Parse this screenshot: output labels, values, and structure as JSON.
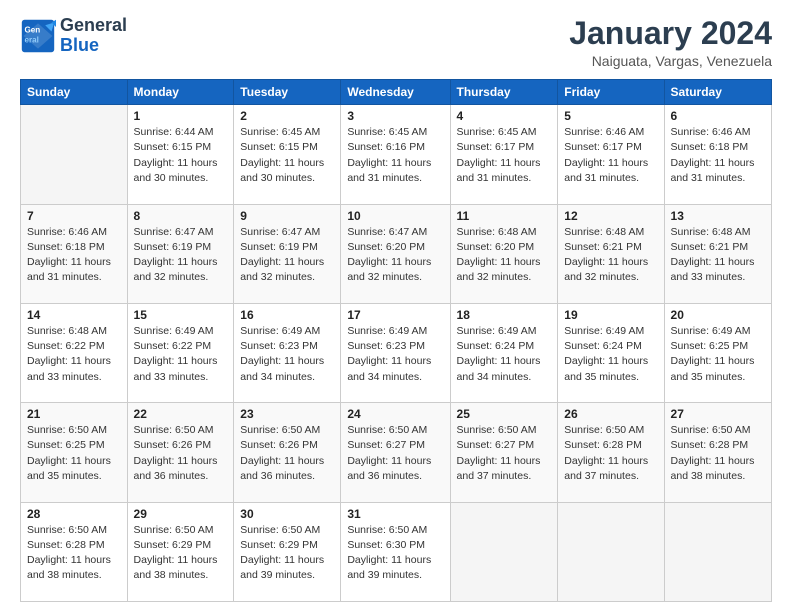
{
  "logo": {
    "line1": "General",
    "line2": "Blue"
  },
  "header": {
    "title": "January 2024",
    "location": "Naiguata, Vargas, Venezuela"
  },
  "weekdays": [
    "Sunday",
    "Monday",
    "Tuesday",
    "Wednesday",
    "Thursday",
    "Friday",
    "Saturday"
  ],
  "weeks": [
    [
      {
        "day": "",
        "empty": true
      },
      {
        "day": "1",
        "sunrise": "Sunrise: 6:44 AM",
        "sunset": "Sunset: 6:15 PM",
        "daylight": "Daylight: 11 hours and 30 minutes."
      },
      {
        "day": "2",
        "sunrise": "Sunrise: 6:45 AM",
        "sunset": "Sunset: 6:15 PM",
        "daylight": "Daylight: 11 hours and 30 minutes."
      },
      {
        "day": "3",
        "sunrise": "Sunrise: 6:45 AM",
        "sunset": "Sunset: 6:16 PM",
        "daylight": "Daylight: 11 hours and 31 minutes."
      },
      {
        "day": "4",
        "sunrise": "Sunrise: 6:45 AM",
        "sunset": "Sunset: 6:17 PM",
        "daylight": "Daylight: 11 hours and 31 minutes."
      },
      {
        "day": "5",
        "sunrise": "Sunrise: 6:46 AM",
        "sunset": "Sunset: 6:17 PM",
        "daylight": "Daylight: 11 hours and 31 minutes."
      },
      {
        "day": "6",
        "sunrise": "Sunrise: 6:46 AM",
        "sunset": "Sunset: 6:18 PM",
        "daylight": "Daylight: 11 hours and 31 minutes."
      }
    ],
    [
      {
        "day": "7",
        "sunrise": "Sunrise: 6:46 AM",
        "sunset": "Sunset: 6:18 PM",
        "daylight": "Daylight: 11 hours and 31 minutes."
      },
      {
        "day": "8",
        "sunrise": "Sunrise: 6:47 AM",
        "sunset": "Sunset: 6:19 PM",
        "daylight": "Daylight: 11 hours and 32 minutes."
      },
      {
        "day": "9",
        "sunrise": "Sunrise: 6:47 AM",
        "sunset": "Sunset: 6:19 PM",
        "daylight": "Daylight: 11 hours and 32 minutes."
      },
      {
        "day": "10",
        "sunrise": "Sunrise: 6:47 AM",
        "sunset": "Sunset: 6:20 PM",
        "daylight": "Daylight: 11 hours and 32 minutes."
      },
      {
        "day": "11",
        "sunrise": "Sunrise: 6:48 AM",
        "sunset": "Sunset: 6:20 PM",
        "daylight": "Daylight: 11 hours and 32 minutes."
      },
      {
        "day": "12",
        "sunrise": "Sunrise: 6:48 AM",
        "sunset": "Sunset: 6:21 PM",
        "daylight": "Daylight: 11 hours and 32 minutes."
      },
      {
        "day": "13",
        "sunrise": "Sunrise: 6:48 AM",
        "sunset": "Sunset: 6:21 PM",
        "daylight": "Daylight: 11 hours and 33 minutes."
      }
    ],
    [
      {
        "day": "14",
        "sunrise": "Sunrise: 6:48 AM",
        "sunset": "Sunset: 6:22 PM",
        "daylight": "Daylight: 11 hours and 33 minutes."
      },
      {
        "day": "15",
        "sunrise": "Sunrise: 6:49 AM",
        "sunset": "Sunset: 6:22 PM",
        "daylight": "Daylight: 11 hours and 33 minutes."
      },
      {
        "day": "16",
        "sunrise": "Sunrise: 6:49 AM",
        "sunset": "Sunset: 6:23 PM",
        "daylight": "Daylight: 11 hours and 34 minutes."
      },
      {
        "day": "17",
        "sunrise": "Sunrise: 6:49 AM",
        "sunset": "Sunset: 6:23 PM",
        "daylight": "Daylight: 11 hours and 34 minutes."
      },
      {
        "day": "18",
        "sunrise": "Sunrise: 6:49 AM",
        "sunset": "Sunset: 6:24 PM",
        "daylight": "Daylight: 11 hours and 34 minutes."
      },
      {
        "day": "19",
        "sunrise": "Sunrise: 6:49 AM",
        "sunset": "Sunset: 6:24 PM",
        "daylight": "Daylight: 11 hours and 35 minutes."
      },
      {
        "day": "20",
        "sunrise": "Sunrise: 6:49 AM",
        "sunset": "Sunset: 6:25 PM",
        "daylight": "Daylight: 11 hours and 35 minutes."
      }
    ],
    [
      {
        "day": "21",
        "sunrise": "Sunrise: 6:50 AM",
        "sunset": "Sunset: 6:25 PM",
        "daylight": "Daylight: 11 hours and 35 minutes."
      },
      {
        "day": "22",
        "sunrise": "Sunrise: 6:50 AM",
        "sunset": "Sunset: 6:26 PM",
        "daylight": "Daylight: 11 hours and 36 minutes."
      },
      {
        "day": "23",
        "sunrise": "Sunrise: 6:50 AM",
        "sunset": "Sunset: 6:26 PM",
        "daylight": "Daylight: 11 hours and 36 minutes."
      },
      {
        "day": "24",
        "sunrise": "Sunrise: 6:50 AM",
        "sunset": "Sunset: 6:27 PM",
        "daylight": "Daylight: 11 hours and 36 minutes."
      },
      {
        "day": "25",
        "sunrise": "Sunrise: 6:50 AM",
        "sunset": "Sunset: 6:27 PM",
        "daylight": "Daylight: 11 hours and 37 minutes."
      },
      {
        "day": "26",
        "sunrise": "Sunrise: 6:50 AM",
        "sunset": "Sunset: 6:28 PM",
        "daylight": "Daylight: 11 hours and 37 minutes."
      },
      {
        "day": "27",
        "sunrise": "Sunrise: 6:50 AM",
        "sunset": "Sunset: 6:28 PM",
        "daylight": "Daylight: 11 hours and 38 minutes."
      }
    ],
    [
      {
        "day": "28",
        "sunrise": "Sunrise: 6:50 AM",
        "sunset": "Sunset: 6:28 PM",
        "daylight": "Daylight: 11 hours and 38 minutes."
      },
      {
        "day": "29",
        "sunrise": "Sunrise: 6:50 AM",
        "sunset": "Sunset: 6:29 PM",
        "daylight": "Daylight: 11 hours and 38 minutes."
      },
      {
        "day": "30",
        "sunrise": "Sunrise: 6:50 AM",
        "sunset": "Sunset: 6:29 PM",
        "daylight": "Daylight: 11 hours and 39 minutes."
      },
      {
        "day": "31",
        "sunrise": "Sunrise: 6:50 AM",
        "sunset": "Sunset: 6:30 PM",
        "daylight": "Daylight: 11 hours and 39 minutes."
      },
      {
        "day": "",
        "empty": true
      },
      {
        "day": "",
        "empty": true
      },
      {
        "day": "",
        "empty": true
      }
    ]
  ]
}
